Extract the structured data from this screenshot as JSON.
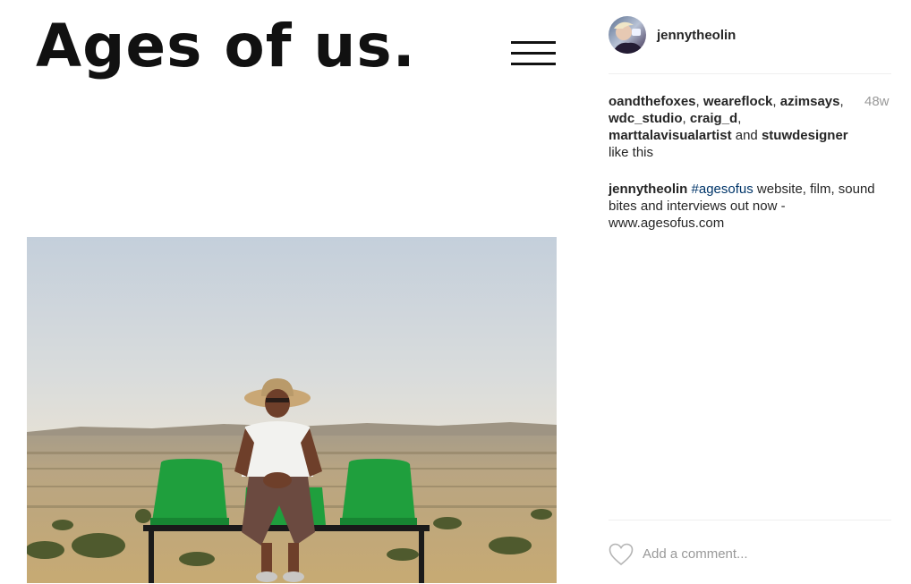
{
  "brand": {
    "title": "Ages of us."
  },
  "post": {
    "username": "jennytheolin",
    "age": "48w",
    "likes": {
      "users": [
        "oandthefoxes",
        "weareflock",
        "azimsays",
        "wdc_studio",
        "craig_d",
        "marttalavisualartist",
        "stuwdesigner"
      ],
      "connector": "and",
      "suffix": "like this"
    },
    "caption": {
      "author": "jennytheolin",
      "hashtag": "#agesofus",
      "text": "website, film, sound bites and interviews out now - www.agesofus.com"
    },
    "comment": {
      "placeholder": "Add a comment..."
    }
  },
  "icons": {
    "menu": "hamburger-menu-icon",
    "like": "heart-outline-icon"
  },
  "colors": {
    "hashtag": "#003569",
    "muted": "#999999",
    "seat": "#1c9a3c"
  }
}
